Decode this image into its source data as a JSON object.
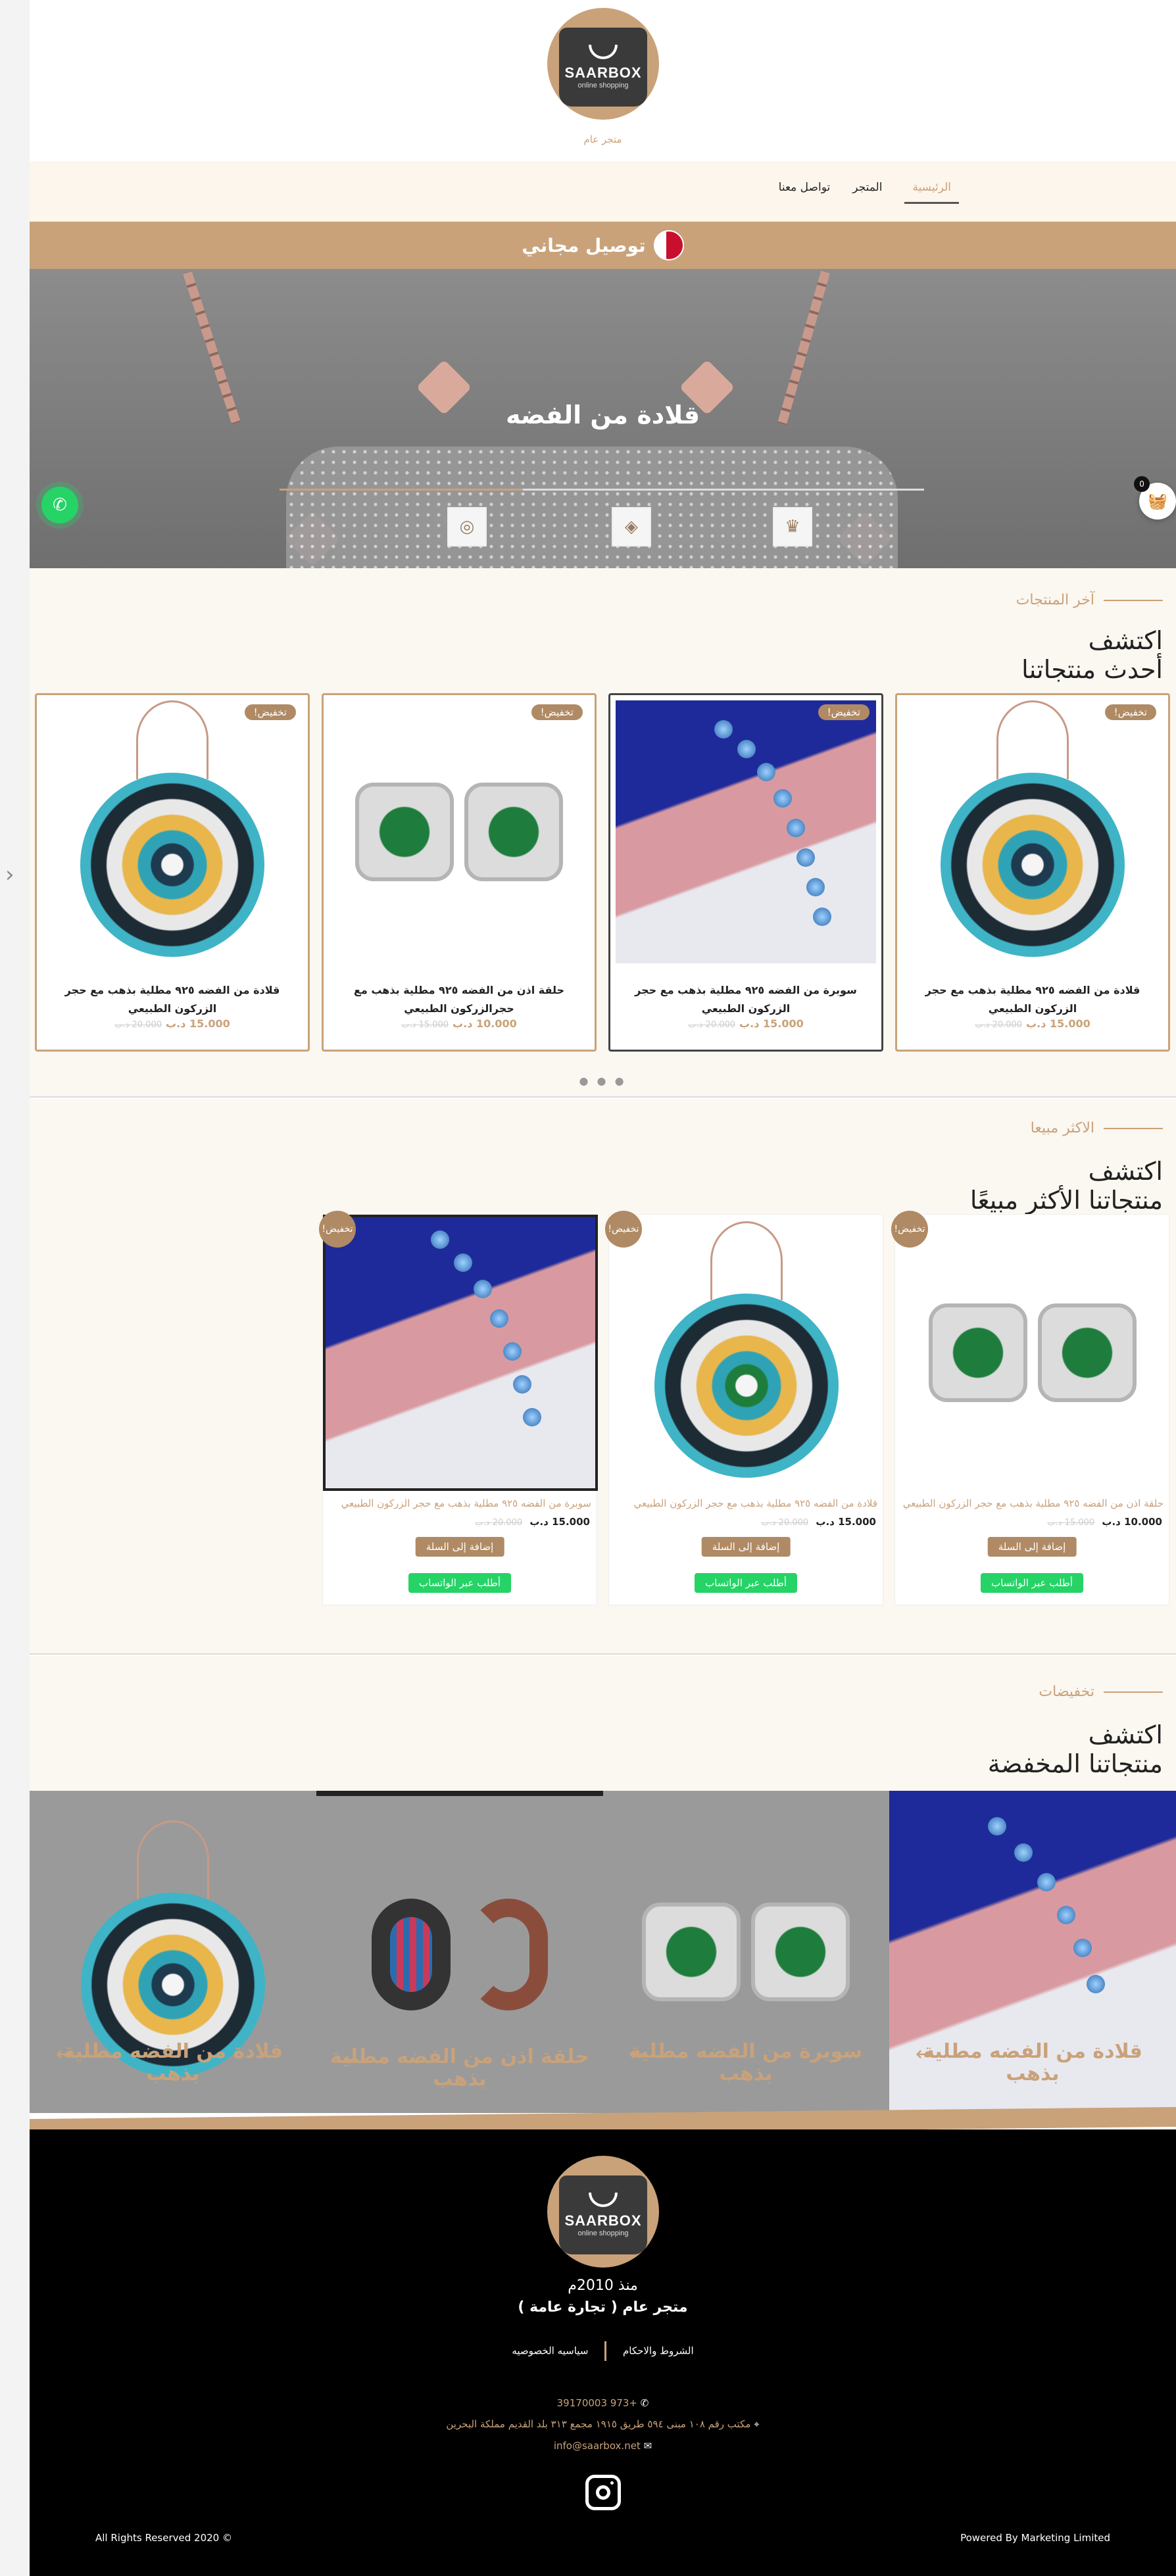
{
  "header": {
    "logo_name": "SAARBOX",
    "logo_tagline": "online shopping",
    "caption": "متجر عام"
  },
  "nav": {
    "items": [
      {
        "label": "الرئيسية",
        "active": true
      },
      {
        "label": "المتجر"
      },
      {
        "label": "تواصل معنا"
      }
    ]
  },
  "promo": {
    "text": "توصيل مجاني"
  },
  "hero": {
    "title": "قلادة من الفضه",
    "slide_progress": 0.38,
    "thumb_icons": [
      "necklace-icon",
      "earring-icon",
      "ring-icon"
    ]
  },
  "floating": {
    "cart_count": "0"
  },
  "latest": {
    "eyebrow": "آخر المنتجات",
    "heading_line1": "اكتشف",
    "heading_line2": "أحدث منتجاتنا",
    "badge": "تخفيض!",
    "products": [
      {
        "title": "قلادة من الفضه ٩٢٥ مطلية بذهب مع حجر الزركون الطبيعي",
        "price": "15.000 د.ب",
        "old_price": "20.000 د.ب",
        "image": "pendant"
      },
      {
        "title": "سوبرة من الفضه ٩٢٥ مطلية بذهب مع حجر الزركون الطبيعي",
        "price": "15.000 د.ب",
        "old_price": "20.000 د.ب",
        "image": "bracelet"
      },
      {
        "title": "حلقة اذن من الفضه ٩٢٥ مطلية بذهب مع حجرالزركون الطبيعي",
        "price": "10.000 د.ب",
        "old_price": "15.000 د.ب",
        "image": "earring"
      },
      {
        "title": "قلادة من الفضه ٩٢٥ مطلية بذهب مع حجر الزركون الطبيعي",
        "price": "15.000 د.ب",
        "old_price": "20.000 د.ب",
        "image": "pendant"
      }
    ],
    "pager": "● ● ●"
  },
  "bestsellers": {
    "eyebrow": "الاكثر مبيعا",
    "heading_line1": "اكتشف",
    "heading_line2": "منتجاتنا الأكثر مبيعًا",
    "badge": "تخفيض!",
    "add_label": "إضافة إلى السلة",
    "whatsapp_label": "أطلب عبر الواتساب",
    "products": [
      {
        "title": "حلقة اذن من الفضه ٩٢٥ مطلية بذهب مع حجر الزركون الطبيعي",
        "price": "10.000 د.ب",
        "old_price": "15.000 د.ب",
        "image": "earring"
      },
      {
        "title": "قلادة من الفضه ٩٢٥ مطلية بذهب مع حجر الزركون الطبيعي",
        "price": "15.000 د.ب",
        "old_price": "20.000 د.ب",
        "image": "pendant"
      },
      {
        "title": "سوبرة من الفضه ٩٢٥ مطلية بذهب مع حجر الزركون الطبيعي",
        "price": "15.000 د.ب",
        "old_price": "20.000 د.ب",
        "image": "bracelet"
      }
    ]
  },
  "discounts": {
    "eyebrow": "تخفيضات",
    "heading_line1": "اكتشف",
    "heading_line2": "منتجاتنا المخفضة",
    "tiles": [
      {
        "title": "قلادة من الفضه مطلية بذهب",
        "image": "bracelet"
      },
      {
        "title": "سوبرة من الفضه مطلية بذهب",
        "image": "earring"
      },
      {
        "title": "حلقة اذن من الفضه مطلية بذهب",
        "image": "hoops"
      },
      {
        "title": "قلادة من الفضه مطلية بذهب",
        "image": "pendant"
      }
    ]
  },
  "footer": {
    "since": "منذ 2010م",
    "company": "متجر عام ( تجارة عامة )",
    "links": [
      "الشروط والاحكام",
      "سياسيه الخصوصيه"
    ],
    "phone": "+973 39170003",
    "address": "مكتب رقم ١٠٨ مبنى ٥٩٤ طريق ١٩١٥ مجمع ٣١٣ بلد القديم مملكة البحرين",
    "email": "info@saarbox.net",
    "copyright": "All Rights Reserved 2020 ©",
    "powered": "Powered By Marketing Limited"
  },
  "colors": {
    "accent": "#c9a27a",
    "whatsapp": "#25d366",
    "footer_bg": "#000000",
    "nav_bg": "#fdf6ec"
  }
}
